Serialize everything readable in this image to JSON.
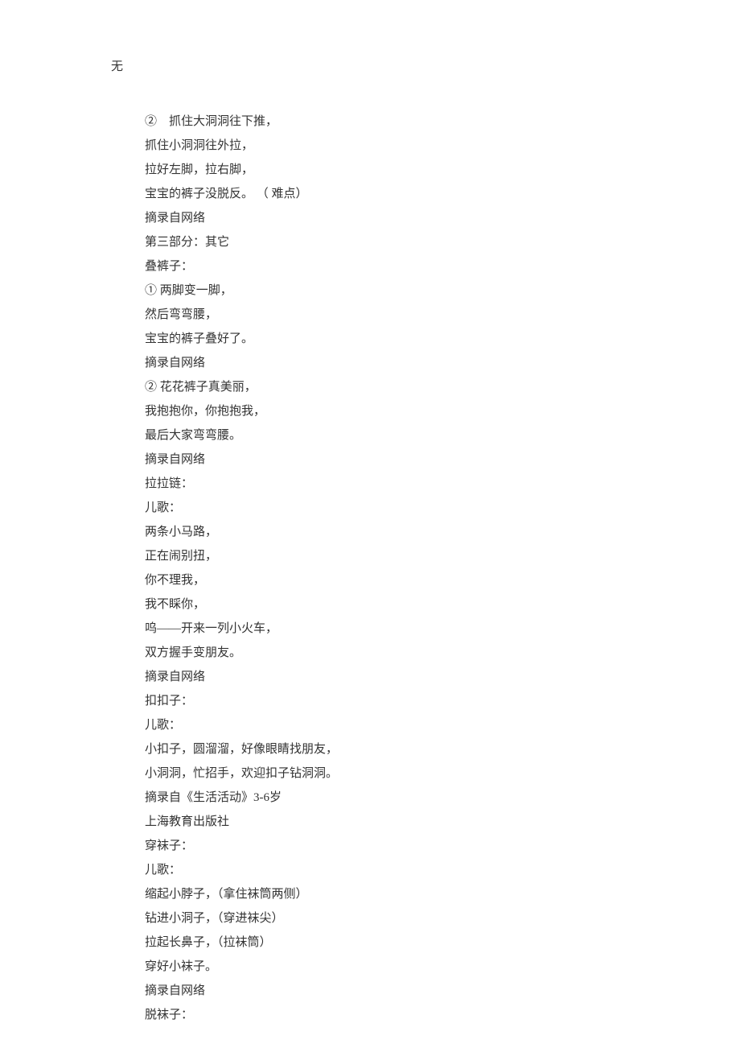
{
  "header": "无",
  "lines": [
    "②　抓住大洞洞往下推，",
    "抓住小洞洞往外拉，",
    "拉好左脚，拉右脚，",
    "宝宝的裤子没脱反。  （ 难点）",
    "摘录自网络",
    "第三部分：其它",
    "叠裤子：",
    "① 两脚变一脚，",
    "然后弯弯腰，",
    "宝宝的裤子叠好了。",
    "摘录自网络",
    "② 花花裤子真美丽，",
    "我抱抱你，你抱抱我，",
    "最后大家弯弯腰。",
    "摘录自网络",
    "拉拉链：",
    "儿歌：",
    "两条小马路，",
    "正在闹别扭，",
    "你不理我，",
    "我不睬你，",
    "呜——开来一列小火车，",
    "双方握手变朋友。",
    "摘录自网络",
    "扣扣子：",
    "儿歌：",
    "小扣子，圆溜溜，好像眼睛找朋友，",
    "小洞洞，忙招手，欢迎扣子钻洞洞。",
    "摘录自《生活活动》3-6岁",
    "上海教育出版社",
    "穿袜子：",
    "儿歌：",
    "缩起小脖子，（拿住袜筒两侧）",
    "钻进小洞子，（穿进袜尖）",
    "拉起长鼻子，（拉袜筒）",
    "穿好小袜子。",
    "摘录自网络",
    "脱袜子："
  ]
}
